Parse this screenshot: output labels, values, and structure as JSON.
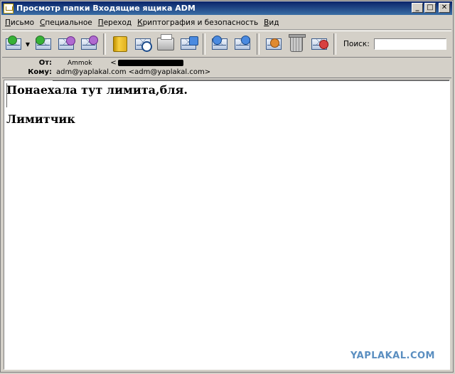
{
  "window": {
    "title": "Просмотр папки Входящие ящика ADM",
    "buttons": {
      "minimize": "_",
      "maximize": "□",
      "close": "✕"
    }
  },
  "menu": [
    {
      "label": "Письмо",
      "underline": "П",
      "rest": "исьмо"
    },
    {
      "label": "Специальное",
      "underline": "С",
      "rest": "пециальное"
    },
    {
      "label": "Переход",
      "underline": "П",
      "rest": "ереход"
    },
    {
      "label": "Криптография и безопасность",
      "underline": "К",
      "rest": "риптография и безопасность"
    },
    {
      "label": "Вид",
      "underline": "В",
      "rest": "ид"
    }
  ],
  "toolbar": {
    "icons": [
      "receive-mail-icon",
      "reply-icon",
      "reply-all-icon",
      "forward-icon",
      "address-book-icon",
      "find-icon",
      "print-icon",
      "save-icon",
      "previous-icon",
      "next-icon",
      "delete-icon",
      "trash-icon",
      "junk-icon"
    ],
    "search_label": "Поиск:",
    "search_value": ""
  },
  "header": {
    "from_label": "От:",
    "from_name": "Ammok",
    "from_addr_open": "<",
    "to_label": "Кому:",
    "to_value": "adm@yaplakal.com <adm@yaplakal.com>"
  },
  "message": {
    "line1": "Понаехала тут лимита,бля.",
    "line2": "Лимитчик"
  },
  "watermark": "YAPLAKAL.COM"
}
